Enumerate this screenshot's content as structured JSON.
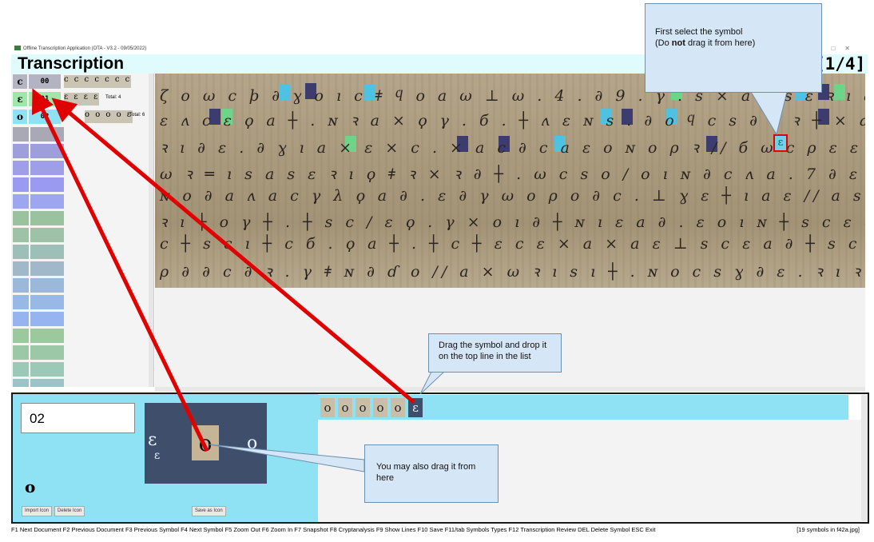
{
  "window": {
    "title": "Offline Transcription Application (OTA - V3.2 - 09/05/2022)",
    "controls": [
      "—",
      "□",
      "✕"
    ]
  },
  "header": {
    "title": "Transcription",
    "page_indicator": "[1/4]"
  },
  "symbol_list": {
    "rows": [
      {
        "glyph": "c",
        "code": "00",
        "samples": "c c c c c c c",
        "total": ""
      },
      {
        "glyph": "ɛ",
        "code": "01",
        "samples": "ɛ ɛ ɛ ɛ",
        "total": "Total: 4"
      },
      {
        "glyph": "o",
        "code": "02",
        "samples": "o o o o ɛ",
        "total": "Total: 6"
      }
    ],
    "empty_colors": [
      "#a9a9b6",
      "#9e9edc",
      "#9f9fe8",
      "#9a9af0",
      "#9ca7f0",
      "#9ac29e",
      "#9ec2a6",
      "#9cc0b8",
      "#a0b8c8",
      "#9cb8d8",
      "#98b8e6",
      "#96b4f0",
      "#9bc89c",
      "#9cc8a8",
      "#9cc8b8",
      "#9cc4c8"
    ]
  },
  "manuscript": {
    "lines": [
      "ζ o ω ϲ ϸ ∂ ɣ o ı ϲ ǂ ϥ o a ω ⊥ ω . 4 . ∂ 9 . 𝛾 . s ⨯ a ϲ s ɛ ꝛ ı a ⨯ a ϲ ɛ ɣ",
      "ɛ ʌ ϲ ɛ ϙ a ┼ . ɴ ꝛ a ⨯ ϙ 𝛾 . б . ┼ ʌ ɛ ɴ s . ∂ o ϥ ϲ s ∂ o ꝛ ┼ ⨯ a ϲ ∂ ω .",
      "ꝛ ı ∂ ɛ . ∂ ɣ ı a ⨯ ɛ ⨯ ϲ . ⨯ a ϲ ∂ ϲ a ɛ o ɴ o ρ ꝛ // б ω ϲ ρ ɛ ɛ ϲ s ꝛ a",
      "ω ꝛ ═ ı s a s ɛ ꝛ ı ϙ ǂ ꝛ ⨯ ꝛ ∂ ┼ . ω ϲ s o / o ı ɴ ∂ ϲ ʌ a . 7 ∂ ɛ . a",
      "ɴ o ∂ a ʌ a ϲ 𝛾 λ ϙ a ∂ . ɛ ∂ 𝛾 ω o ρ o ∂ ϲ . ⊥ ɣ ɛ ┼ ı a ɛ // a s ϲ ɛ 8",
      "ꝛ ı ┼ o 𝛾 ┼ . ┼ s ϲ / ɛ ϙ . 𝛾 ⨯ o ı ∂ ┼ ɴ ı ɛ a ∂ . ɛ o ı ɴ ┼ s ϲ ɛ ∂ ϲ ɛ ⨯",
      "ϲ ┼ s ϲ ı ┼ ϲ б . ϙ a ┼ . ┼ ϲ ┼ ɛ ϲ ɛ ⨯ a ⨯ a ɛ ⊥ s ϲ ɛ a ∂ ┼ s ϲ ɛ ⨯ ϲ . ɛ",
      "ρ ∂ ∂ ϲ ∂ ꝛ . 𝛾 ǂ ɴ ∂ ɗ o // a ⨯ ω ꝛ ı s ı ┼ . ɴ o ϲ s ɣ ∂ ɛ . ꝛ ı ꝛ a ┼ . ϲ"
    ]
  },
  "editor": {
    "code_value": "02",
    "preview_glyph": "o",
    "zoom_glyph": "o",
    "buttons": {
      "import_icon": "Import Icon",
      "delete_icon": "Delete Icon",
      "save_as_icon": "Save as Icon"
    },
    "strip_symbols": [
      "o",
      "o",
      "o",
      "o",
      "o",
      "ɛ"
    ]
  },
  "status_bar": {
    "shortcuts": "F1 Next Document F2 Previous Document F3 Previous Symbol F4 Next Symbol F5 Zoom Out F6 Zoom In F7 Snapshot F8 Cryptanalysis F9 Show Lines F10 Save F11/tab Symbols Types F12 Transcription Review DEL Delete Symbol ESC Exit",
    "summary": "[19 symbols in f42a.jpg]"
  },
  "callouts": {
    "top_pre": "First select the symbol",
    "top_post_pre": "(Do ",
    "top_bold": "not",
    "top_post": " drag it from here)",
    "middle": "Drag the symbol and drop it on the top line in the list",
    "bottom": "You may also drag it from here"
  },
  "colors": {
    "highlight_blue": "#4ec2e0",
    "highlight_green": "#6fd48a",
    "highlight_navy": "#3c3c6e",
    "arrow_red": "#e00000"
  }
}
